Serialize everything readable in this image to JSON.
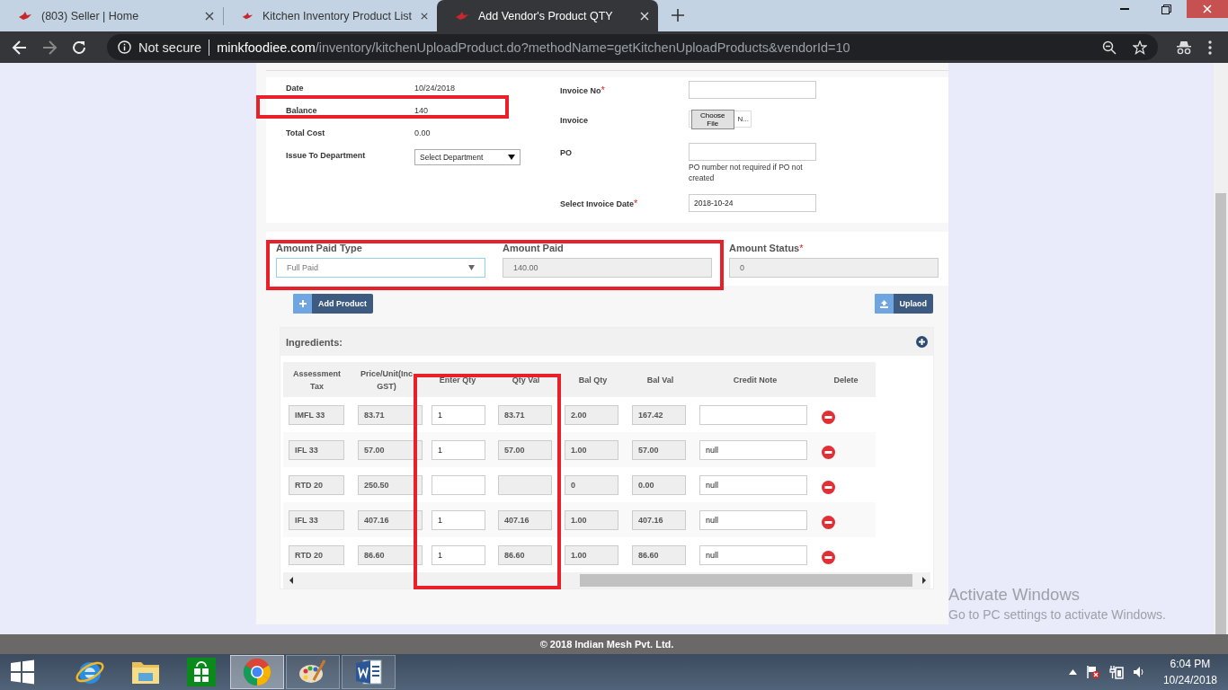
{
  "browser": {
    "tabs": [
      {
        "title": "(803) Seller | Home",
        "selected": false
      },
      {
        "title": "Kitchen Inventory Product List",
        "selected": false
      },
      {
        "title": "Add Vendor's Product QTY",
        "selected": true
      }
    ],
    "address": {
      "security": "Not secure",
      "host": "minkfoodiee.com",
      "path": "/inventory/kitchenUploadProduct.do?methodName=getKitchenUploadProducts&vendorId=10"
    }
  },
  "details": {
    "left": [
      {
        "label": "Date",
        "kind": "text",
        "value": "10/24/2018"
      },
      {
        "label": "Balance",
        "kind": "text",
        "value": "140"
      },
      {
        "label": "Total Cost",
        "kind": "text",
        "value": "0.00"
      },
      {
        "label": "Issue To Department",
        "kind": "select",
        "value": "Select Department"
      }
    ],
    "right": [
      {
        "label": "Invoice No",
        "mark": "*",
        "kind": "input"
      },
      {
        "label": "Invoice",
        "kind": "file",
        "button": "Choose File",
        "value": "N..."
      },
      {
        "label": "PO",
        "kind": "input",
        "hint": "PO number not required if PO not created"
      },
      {
        "label": "Select Invoice Date",
        "mark": "*",
        "kind": "input",
        "value": "2018-10-24"
      }
    ]
  },
  "payment": [
    {
      "label": "Amount Paid Type",
      "kind": "select",
      "value": "Full Paid"
    },
    {
      "label": "Amount Paid",
      "kind": "readonly",
      "value": "140.00"
    },
    {
      "label": "Amount Status",
      "mark": "*",
      "kind": "readonly",
      "value": "0"
    }
  ],
  "actions": {
    "add": "Add Product",
    "upload": "Uplaod"
  },
  "ingredients": {
    "title": "Ingredients:",
    "columns": [
      "Assessment Tax",
      "Price/Unit(Inc GST)",
      "Enter Qty",
      "Qty Val",
      "Bal Qty",
      "Bal Val",
      "Credit Note",
      "Delete"
    ],
    "rows": [
      {
        "cells": [
          {
            "kind": "readonly",
            "value": "IMFL 33"
          },
          {
            "kind": "readonly",
            "value": "83.71"
          },
          {
            "kind": "input",
            "value": "1"
          },
          {
            "kind": "readonly",
            "value": "83.71"
          },
          {
            "kind": "readonly",
            "value": "2.00"
          },
          {
            "kind": "readonly",
            "value": "167.42"
          },
          {
            "kind": "input"
          },
          {
            "kind": "delete"
          }
        ]
      },
      {
        "cells": [
          {
            "kind": "readonly",
            "value": "IFL 33"
          },
          {
            "kind": "readonly",
            "value": "57.00"
          },
          {
            "kind": "input",
            "value": "1"
          },
          {
            "kind": "readonly",
            "value": "57.00"
          },
          {
            "kind": "readonly",
            "value": "1.00"
          },
          {
            "kind": "readonly",
            "value": "57.00"
          },
          {
            "kind": "input",
            "value": "null"
          },
          {
            "kind": "delete"
          }
        ]
      },
      {
        "cells": [
          {
            "kind": "readonly",
            "value": "RTD 20"
          },
          {
            "kind": "readonly",
            "value": "250.50"
          },
          {
            "kind": "input"
          },
          {
            "kind": "readonly"
          },
          {
            "kind": "readonly",
            "value": "0"
          },
          {
            "kind": "readonly",
            "value": "0.00"
          },
          {
            "kind": "input",
            "value": "null"
          },
          {
            "kind": "delete"
          }
        ]
      },
      {
        "cells": [
          {
            "kind": "readonly",
            "value": "IFL 33"
          },
          {
            "kind": "readonly",
            "value": "407.16"
          },
          {
            "kind": "input",
            "value": "1"
          },
          {
            "kind": "readonly",
            "value": "407.16"
          },
          {
            "kind": "readonly",
            "value": "1.00"
          },
          {
            "kind": "readonly",
            "value": "407.16"
          },
          {
            "kind": "input",
            "value": "null"
          },
          {
            "kind": "delete"
          }
        ]
      },
      {
        "cells": [
          {
            "kind": "readonly",
            "value": "RTD 20"
          },
          {
            "kind": "readonly",
            "value": "86.60"
          },
          {
            "kind": "input",
            "value": "1"
          },
          {
            "kind": "readonly",
            "value": "86.60"
          },
          {
            "kind": "readonly",
            "value": "1.00"
          },
          {
            "kind": "readonly",
            "value": "86.60"
          },
          {
            "kind": "input",
            "value": "null"
          },
          {
            "kind": "delete"
          }
        ]
      }
    ]
  },
  "footer": "© 2018 Indian Mesh Pvt. Ltd.",
  "activation": {
    "title": "Activate Windows",
    "subtitle": "Go to PC settings to activate Windows."
  },
  "taskbar": {
    "apps": [
      {
        "kind": "ie",
        "selected": false
      },
      {
        "kind": "explorer",
        "selected": false
      },
      {
        "kind": "store",
        "selected": false
      },
      {
        "kind": "chrome",
        "selected": true
      },
      {
        "kind": "paint",
        "selected": false
      },
      {
        "kind": "word",
        "selected": false
      }
    ],
    "time": "6:04 PM",
    "date": "10/24/2018"
  }
}
